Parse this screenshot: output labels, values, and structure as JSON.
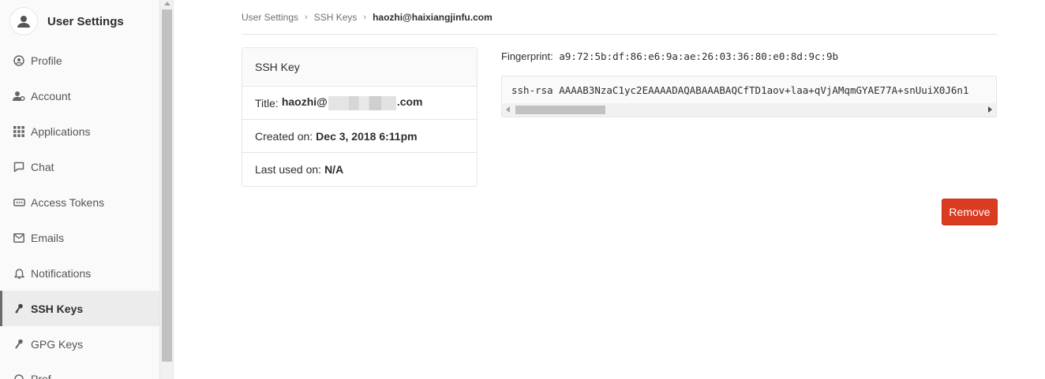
{
  "sidebar": {
    "title": "User Settings",
    "items": [
      {
        "label": "Profile",
        "icon": "profile-icon"
      },
      {
        "label": "Account",
        "icon": "account-icon"
      },
      {
        "label": "Applications",
        "icon": "applications-icon"
      },
      {
        "label": "Chat",
        "icon": "chat-icon"
      },
      {
        "label": "Access Tokens",
        "icon": "token-icon"
      },
      {
        "label": "Emails",
        "icon": "email-icon"
      },
      {
        "label": "Notifications",
        "icon": "bell-icon"
      },
      {
        "label": "SSH Keys",
        "icon": "key-icon",
        "active": true
      },
      {
        "label": "GPG Keys",
        "icon": "key-icon"
      },
      {
        "label": "Pref",
        "icon": "preferences-icon"
      }
    ]
  },
  "breadcrumb": [
    "User Settings",
    "SSH Keys",
    "haozhi@haixiangjinfu.com"
  ],
  "key_card": {
    "header": "SSH Key",
    "title_label": "Title:",
    "title_prefix": "haozhi@",
    "title_suffix": ".com",
    "created_label": "Created on:",
    "created_value": "Dec 3, 2018 6:11pm",
    "last_used_label": "Last used on:",
    "last_used_value": "N/A"
  },
  "fingerprint": {
    "label": "Fingerprint:",
    "value": "a9:72:5b:df:86:e6:9a:ae:26:03:36:80:e0:8d:9c:9b"
  },
  "key_text": "ssh-rsa AAAAB3NzaC1yc2EAAAADAQABAAABAQCfTD1aov+laa+qVjAMqmGYAE77A+snUuiX0J6n1",
  "remove_label": "Remove",
  "colors": {
    "danger": "#db3b21",
    "active_bar": "#6b6b6b"
  }
}
